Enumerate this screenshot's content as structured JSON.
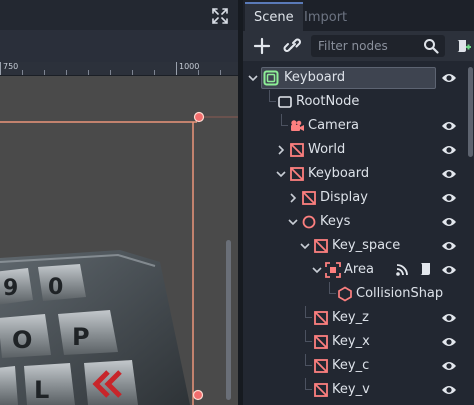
{
  "viewport": {
    "ruler": {
      "labels": [
        "750",
        "1000"
      ]
    },
    "keycaps": [
      "9",
      "0",
      "O",
      "P",
      "L"
    ]
  },
  "dock": {
    "tabs": [
      {
        "label": "Scene"
      },
      {
        "label": "Import"
      }
    ],
    "filter": {
      "placeholder": "Filter nodes"
    }
  },
  "tree": {
    "nodes": [
      {
        "label": "Keyboard",
        "icon": "scene-root-icon"
      },
      {
        "label": "RootNode",
        "icon": "node3d-icon"
      },
      {
        "label": "Camera",
        "icon": "camera-icon"
      },
      {
        "label": "World",
        "icon": "spatial-node-icon"
      },
      {
        "label": "Keyboard",
        "icon": "spatial-node-icon"
      },
      {
        "label": "Display",
        "icon": "spatial-node-icon"
      },
      {
        "label": "Keys",
        "icon": "circle-node-icon"
      },
      {
        "label": "Key_space",
        "icon": "spatial-node-icon"
      },
      {
        "label": "Area",
        "icon": "area-icon"
      },
      {
        "label": "CollisionShap",
        "icon": "collision-shape-icon"
      },
      {
        "label": "Key_z",
        "icon": "spatial-node-icon"
      },
      {
        "label": "Key_x",
        "icon": "spatial-node-icon"
      },
      {
        "label": "Key_c",
        "icon": "spatial-node-icon"
      },
      {
        "label": "Key_v",
        "icon": "spatial-node-icon"
      }
    ]
  },
  "colors": {
    "accent_orange": "#e9957a",
    "node_red": "#fc7f7f",
    "selection_outline": "#8eef97",
    "collision_blue": "#a5b7f3"
  }
}
